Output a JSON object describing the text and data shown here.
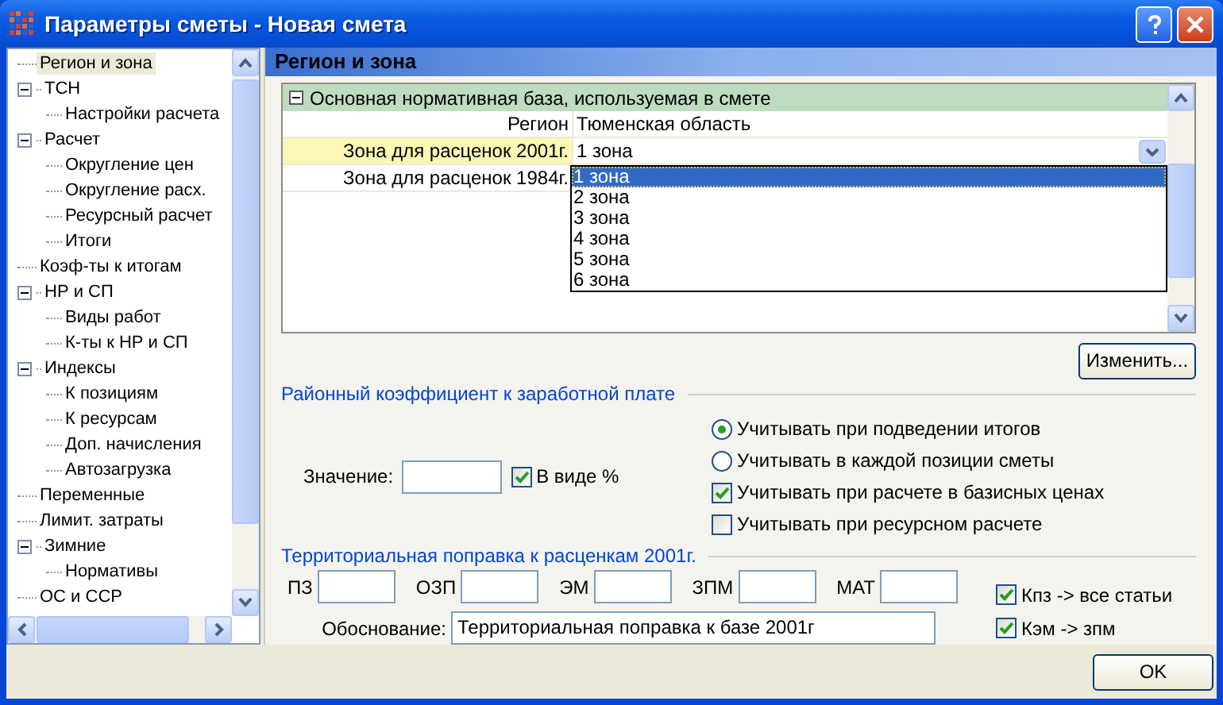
{
  "window": {
    "title": "Параметры сметы - Новая смета"
  },
  "tree": [
    {
      "label": "Регион и зона",
      "selected": true
    },
    {
      "label": "ТСН",
      "selected": false,
      "expanded": true,
      "children": [
        {
          "label": "Настройки расчета",
          "selected": false
        }
      ]
    },
    {
      "label": "Расчет",
      "selected": false,
      "expanded": true,
      "children": [
        {
          "label": "Округление цен",
          "selected": false
        },
        {
          "label": "Округление расх.",
          "selected": false
        },
        {
          "label": "Ресурсный расчет",
          "selected": false
        },
        {
          "label": "Итоги",
          "selected": false
        }
      ]
    },
    {
      "label": "Коэф-ты к итогам",
      "selected": false
    },
    {
      "label": "НР и СП",
      "selected": false,
      "expanded": true,
      "children": [
        {
          "label": "Виды работ",
          "selected": false
        },
        {
          "label": "К-ты к НР и СП",
          "selected": false
        }
      ]
    },
    {
      "label": "Индексы",
      "selected": false,
      "expanded": true,
      "children": [
        {
          "label": "К позициям",
          "selected": false
        },
        {
          "label": "К ресурсам",
          "selected": false
        },
        {
          "label": "Доп. начисления",
          "selected": false
        },
        {
          "label": "Автозагрузка",
          "selected": false
        }
      ]
    },
    {
      "label": "Переменные",
      "selected": false
    },
    {
      "label": "Лимит. затраты",
      "selected": false
    },
    {
      "label": "Зимние",
      "selected": false,
      "expanded": true,
      "children": [
        {
          "label": "Нормативы",
          "selected": false
        }
      ]
    },
    {
      "label": "ОС и ССР",
      "selected": false
    }
  ],
  "panel": {
    "title": "Регион и зона"
  },
  "property_grid": {
    "category": {
      "label": "Основная нормативная база, используемая в смете",
      "expanded": true
    },
    "rows": [
      {
        "name": "Регион",
        "value": "Тюменская область",
        "selected": false,
        "kind": "text"
      },
      {
        "name": "Зона для расценок 2001г.",
        "value": "1 зона",
        "selected": true,
        "kind": "dropdown"
      },
      {
        "name": "Зона для расценок 1984г.",
        "selected": false,
        "kind": "text"
      }
    ],
    "dropdown_options": [
      {
        "label": "1 зона",
        "selected": true
      },
      {
        "label": "2 зона",
        "selected": false
      },
      {
        "label": "3 зона",
        "selected": false
      },
      {
        "label": "4 зона",
        "selected": false
      },
      {
        "label": "5 зона",
        "selected": false
      },
      {
        "label": "6 зона",
        "selected": false
      }
    ]
  },
  "change_button": {
    "label": "Изменить..."
  },
  "wage_coefficient": {
    "title": "Районный коэффициент к заработной плате",
    "value_label": "Значение:",
    "percent": {
      "label": "В виде %",
      "checked": true
    },
    "options": [
      {
        "kind": "radio",
        "label": "Учитывать при подведении итогов",
        "selected": true
      },
      {
        "kind": "radio",
        "label": "Учитывать в каждой позиции сметы",
        "selected": false
      },
      {
        "kind": "checkbox",
        "label": "Учитывать при расчете в базисных ценах",
        "checked": true
      },
      {
        "kind": "checkbox",
        "label": "Учитывать при ресурсном расчете",
        "checked": false
      }
    ]
  },
  "territorial": {
    "title": "Территориальная поправка к расценкам 2001г.",
    "fields": [
      {
        "label": "ПЗ"
      },
      {
        "label": "ОЗП"
      },
      {
        "label": "ЭМ"
      },
      {
        "label": "ЗПМ"
      },
      {
        "label": "МАТ"
      }
    ],
    "basis": {
      "label": "Обоснование:",
      "value": "Территориальная поправка к базе 2001г"
    },
    "checks": [
      {
        "label": "Кпз -> все статьи",
        "checked": true
      },
      {
        "label": "Кэм -> зпм",
        "checked": true
      }
    ]
  },
  "ok_button": {
    "label": "OK"
  }
}
